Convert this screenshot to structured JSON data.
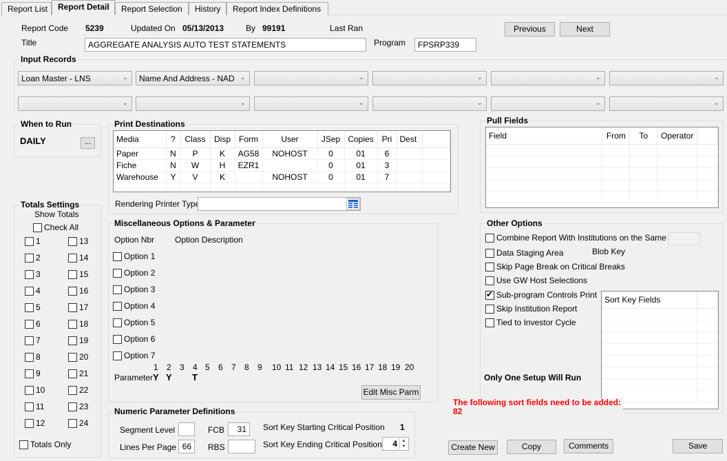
{
  "tabs": [
    {
      "label": "Report List",
      "active": false
    },
    {
      "label": "Report Detail",
      "active": true
    },
    {
      "label": "Report Selection",
      "active": false
    },
    {
      "label": "History",
      "active": false
    },
    {
      "label": "Report Index Definitions",
      "active": false
    }
  ],
  "header": {
    "report_code_label": "Report Code",
    "report_code": "5239",
    "updated_on_label": "Updated On",
    "updated_on": "05/13/2013",
    "by_label": "By",
    "by": "99191",
    "last_ran_label": "Last Ran",
    "title_label": "Title",
    "title_value": "AGGREGATE ANALYSIS AUTO TEST STATEMENTS",
    "program_label": "Program",
    "program_value": "FPSRP339",
    "previous_label": "Previous",
    "next_label": "Next"
  },
  "input_records": {
    "title": "Input Records",
    "row1": [
      "Loan Master - LNS",
      "Name And Address - NAD",
      "",
      "",
      "",
      ""
    ],
    "row2": [
      "",
      "",
      "",
      "",
      "",
      ""
    ]
  },
  "when_to_run": {
    "title": "When to Run",
    "value": "DAILY",
    "button_label": "..."
  },
  "print_destinations": {
    "title": "Print Destinations",
    "columns": [
      "Media",
      "?",
      "Class",
      "Disp",
      "Form",
      "User",
      "JSep",
      "Copies",
      "Pri",
      "Dest"
    ],
    "rows": [
      [
        "Paper",
        "N",
        "P",
        "K",
        "AG58",
        "NOHOST",
        "0",
        "01",
        "6",
        ""
      ],
      [
        "Fiche",
        "N",
        "W",
        "H",
        "EZR1",
        "",
        "0",
        "01",
        "3",
        ""
      ],
      [
        "Warehouse",
        "Y",
        "V",
        "K",
        "",
        "NOHOST",
        "0",
        "01",
        "7",
        ""
      ]
    ],
    "rendering_printer_label": "Rendering Printer Type",
    "rendering_printer_value": ""
  },
  "pull_fields": {
    "title": "Pull Fields",
    "columns": [
      "Field",
      "From",
      "To",
      "Operator"
    ],
    "rows": []
  },
  "totals": {
    "title": "Totals Settings",
    "show_totals_label": "Show Totals",
    "check_all_label": "Check All",
    "items": [
      "1",
      "2",
      "3",
      "4",
      "5",
      "6",
      "7",
      "8",
      "9",
      "10",
      "11",
      "12",
      "13",
      "14",
      "15",
      "16",
      "17",
      "18",
      "19",
      "20",
      "21",
      "22",
      "23",
      "24"
    ],
    "totals_only_label": "Totals Only"
  },
  "misc": {
    "title": "Miscellaneous Options & Parameter",
    "col_nbr": "Option Nbr",
    "col_desc": "Option Description",
    "options": [
      "Option 1",
      "Option 2",
      "Option 3",
      "Option 4",
      "Option 5",
      "Option 6",
      "Option 7"
    ],
    "param_numbers": [
      "1",
      "2",
      "3",
      "4",
      "5",
      "6",
      "7",
      "8",
      "9",
      "10",
      "11",
      "12",
      "13",
      "14",
      "15",
      "16",
      "17",
      "18",
      "19",
      "20"
    ],
    "param_label": "Parameter",
    "param_values": [
      "Y",
      "Y",
      "",
      "T",
      "",
      "",
      "",
      "",
      "",
      "",
      "",
      "",
      "",
      "",
      "",
      "",
      "",
      "",
      "",
      ""
    ],
    "edit_button": "Edit Misc Parm"
  },
  "numeric": {
    "title": "Numeric Parameter Definitions",
    "segment_level_label": "Segment Level",
    "segment_level": "",
    "fcb_label": "FCB",
    "fcb": "31",
    "lines_per_page_label": "Lines Per Page",
    "lines_per_page": "66",
    "rbs_label": "RBS",
    "rbs": "",
    "sort_start_label": "Sort Key Starting Critical  Position",
    "sort_start": "1",
    "sort_end_label": "Sort Key Ending Critical  Position",
    "sort_end": "4"
  },
  "other_options": {
    "title": "Other Options",
    "options": [
      {
        "label": "Combine Report With Institutions on the Same Set",
        "checked": false
      },
      {
        "label": "Data Staging Area",
        "checked": false
      },
      {
        "label": "Skip Page Break on Critical Breaks",
        "checked": false
      },
      {
        "label": "Use GW Host Selections",
        "checked": false
      },
      {
        "label": "Sub-program Controls Print",
        "checked": true
      },
      {
        "label": "Skip Institution Report",
        "checked": false
      },
      {
        "label": "Tied to Investor Cycle",
        "checked": false
      }
    ],
    "blob_key_label": "Blob Key",
    "sort_key_header": "Sort Key Fields",
    "only_one_setup": "Only One Setup Will Run",
    "warning_line1": "The following sort fields need to be added:",
    "warning_line2": "82"
  },
  "footer": {
    "create_new": "Create New",
    "copy": "Copy",
    "comments": "Comments",
    "save": "Save"
  },
  "colors": {
    "warning": "#ff0000",
    "background": "#f0f0f0"
  }
}
